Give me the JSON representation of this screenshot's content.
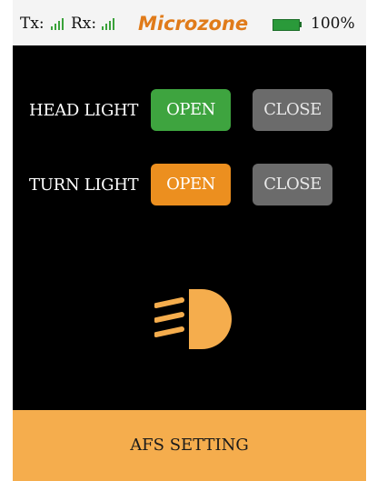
{
  "status_bar": {
    "tx_label": "Tx:",
    "rx_label": "Rx:",
    "brand": "Microzone",
    "battery_percent": "100%",
    "signal_icon": "signal-bars-icon",
    "battery_icon": "battery-icon"
  },
  "head_light": {
    "label": "HEAD LIGHT",
    "open_label": "OPEN",
    "close_label": "CLOSE",
    "state": "open"
  },
  "turn_light": {
    "label": "TURN LIGHT",
    "open_label": "OPEN",
    "close_label": "CLOSE",
    "state": "open"
  },
  "indicator": {
    "icon": "headlight-icon"
  },
  "footer": {
    "label": "AFS SETTING"
  },
  "colors": {
    "open_head": "#3ea43f",
    "open_turn": "#ec8f1f",
    "close": "#6b6b6b",
    "icon": "#f5ad4d",
    "brand": "#e07b1a",
    "footer": "#f5ad4d",
    "signal": "#3aa23a",
    "battery": "#2a9a3a"
  }
}
